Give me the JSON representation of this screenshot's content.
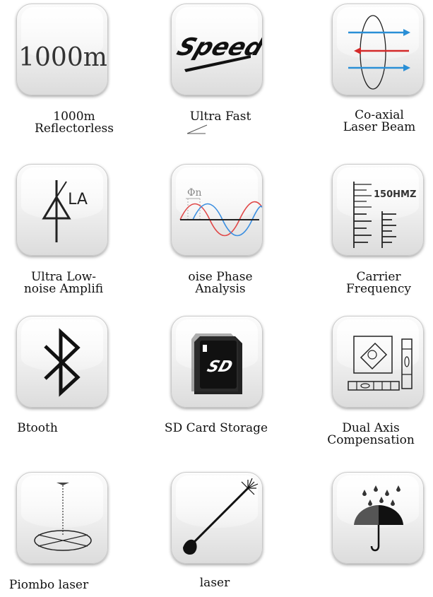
{
  "features": [
    {
      "icon": "distance-1000m-icon",
      "icon_text": "1000m",
      "lines": [
        "1000m",
        "Reflectorless"
      ]
    },
    {
      "icon": "speed-icon",
      "icon_text": "Speed",
      "lines": [
        "Ultra Fast"
      ]
    },
    {
      "icon": "coaxial-laser-beam-icon",
      "lines": [
        "Co-axial",
        "Laser Beam"
      ]
    },
    {
      "icon": "amplifier-icon",
      "icon_text": "LA",
      "lines": [
        "Ultra Low-",
        "noise Amplifi"
      ]
    },
    {
      "icon": "phase-wave-icon",
      "icon_text": "Φn",
      "lines": [
        "oise Phase",
        "Analysis"
      ]
    },
    {
      "icon": "frequency-scale-icon",
      "icon_text": "150HMZ",
      "lines": [
        "Carrier",
        "Frequency"
      ]
    },
    {
      "icon": "bluetooth-icon",
      "lines": [
        "Btooth"
      ]
    },
    {
      "icon": "sd-card-icon",
      "icon_text": "SD",
      "lines": [
        "SD Card Storage"
      ]
    },
    {
      "icon": "dual-axis-level-icon",
      "lines": [
        "Dual Axis",
        "Compensation"
      ]
    },
    {
      "icon": "plumb-laser-icon",
      "lines": [
        "Piombo laser"
      ]
    },
    {
      "icon": "laser-pointer-icon",
      "lines": [
        "laser"
      ]
    },
    {
      "icon": "rain-umbrella-icon",
      "lines": []
    }
  ],
  "colors": {
    "laser_red": "#d42a2a",
    "laser_blue": "#2a8fd6",
    "wave_red": "#e04848",
    "wave_blue": "#3a8ee0"
  }
}
